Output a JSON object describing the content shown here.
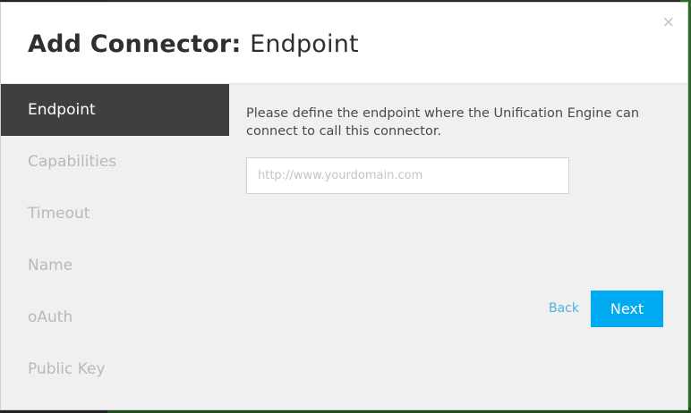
{
  "modal": {
    "title_bold": "Add Connector:",
    "title_rest": "Endpoint",
    "close_symbol": "×"
  },
  "sidebar": {
    "items": [
      {
        "label": "Endpoint",
        "active": true
      },
      {
        "label": "Capabilities",
        "active": false
      },
      {
        "label": "Timeout",
        "active": false
      },
      {
        "label": "Name",
        "active": false
      },
      {
        "label": "oAuth",
        "active": false
      },
      {
        "label": "Public Key",
        "active": false
      }
    ]
  },
  "content": {
    "description": "Please define the endpoint where the Unification Engine can connect to call this connector.",
    "endpoint_input": {
      "value": "",
      "placeholder": "http://www.yourdomain.com"
    },
    "back_label": "Back",
    "next_label": "Next"
  },
  "colors": {
    "accent": "#00aaf0",
    "link": "#47b3e0",
    "sidebar_active_bg": "#3f3f3f"
  }
}
